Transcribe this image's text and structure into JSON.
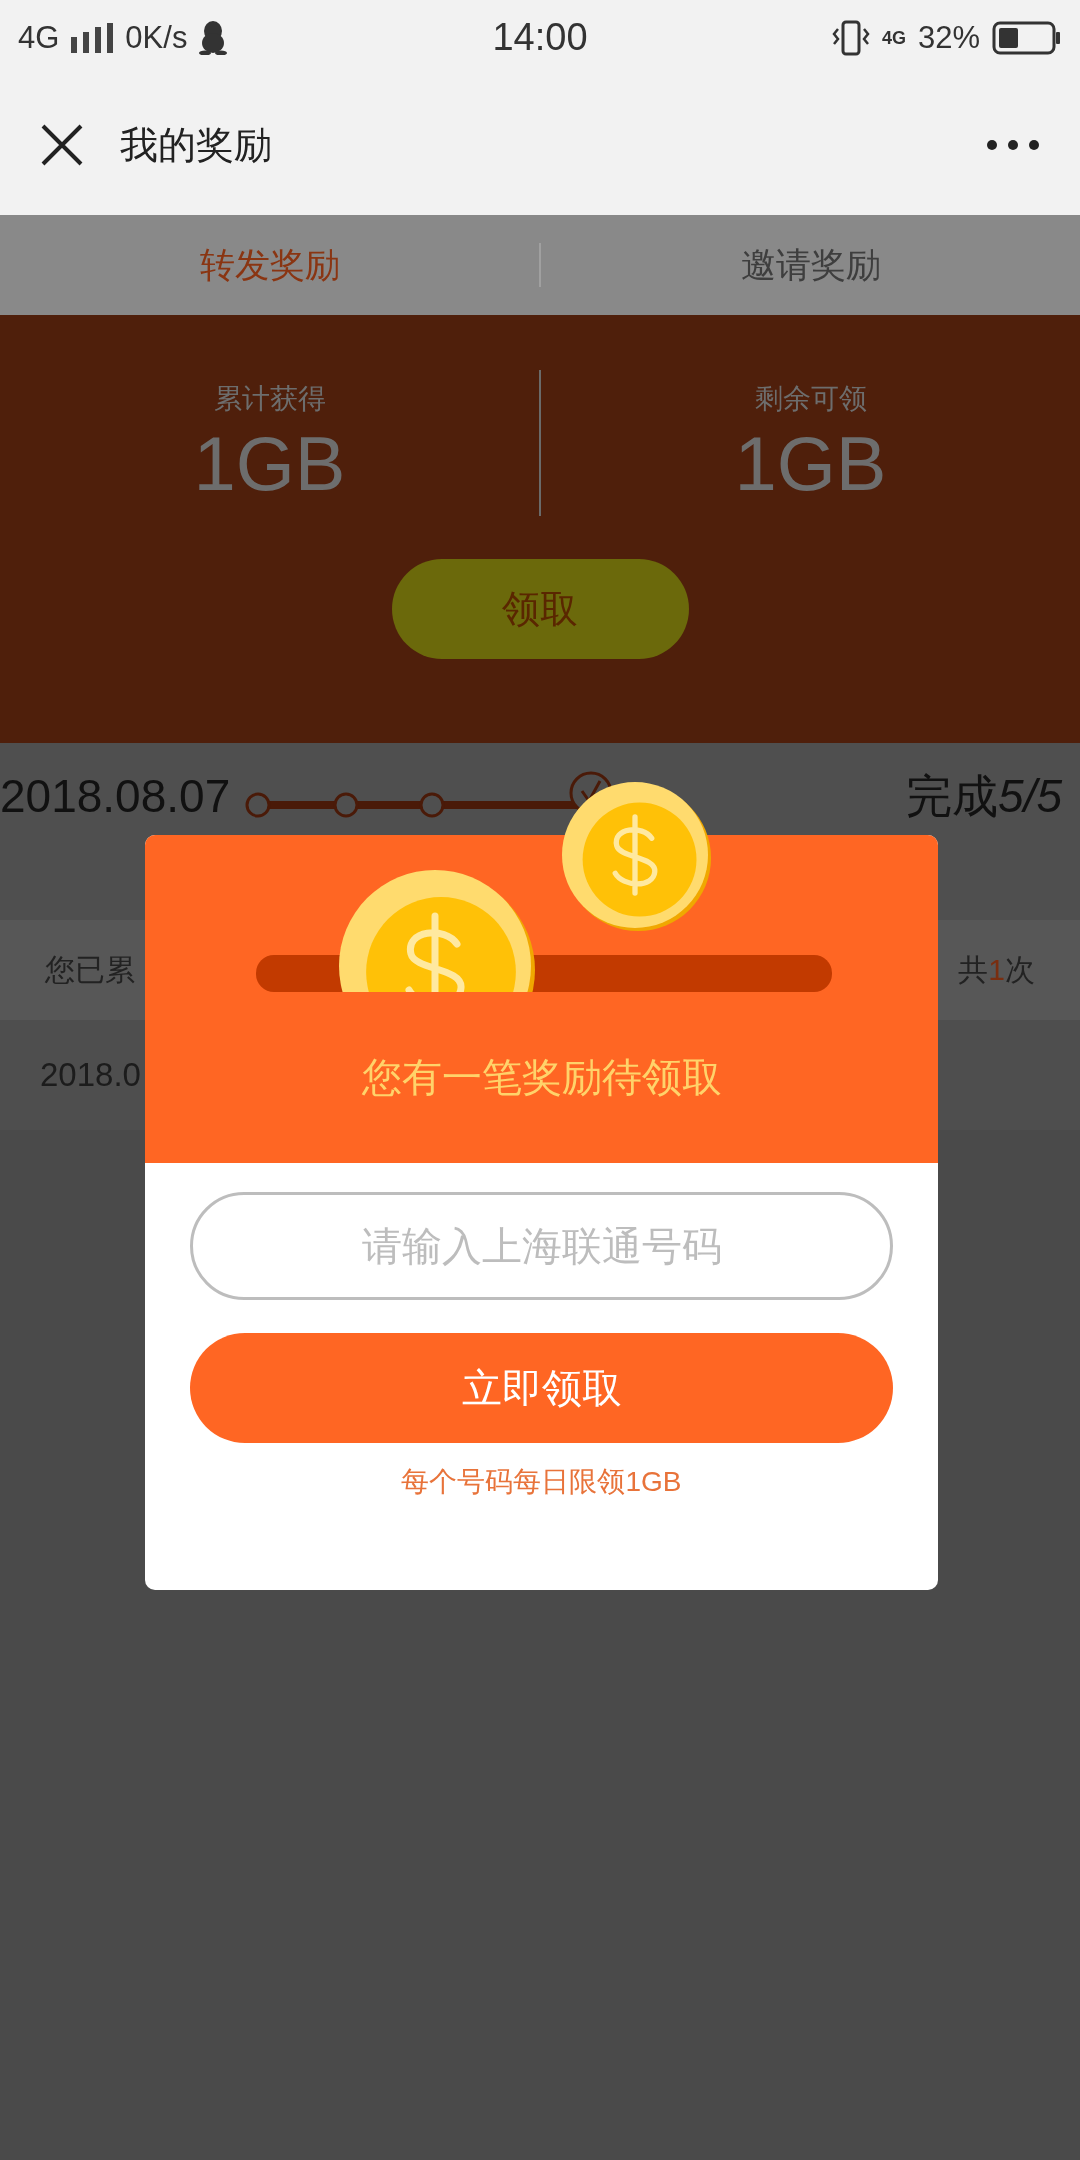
{
  "status_bar": {
    "network": "4G",
    "speed": "0K/s",
    "time": "14:00",
    "network_right": "4G",
    "battery": "32%"
  },
  "header": {
    "title": "我的奖励"
  },
  "tabs": [
    {
      "label": "转发奖励",
      "selected": true
    },
    {
      "label": "邀请奖励",
      "selected": false
    }
  ],
  "summary": {
    "stats": [
      {
        "label": "累计获得",
        "value": "1GB"
      },
      {
        "label": "剩余可领",
        "value": "1GB"
      }
    ],
    "button": "领取"
  },
  "progress": {
    "date": "2018.08.07",
    "status_label": "完成",
    "status_value": "5/5"
  },
  "record_summary": {
    "text": "您已累",
    "count_prefix": "共",
    "count": "1",
    "count_suffix": "次"
  },
  "records": [
    {
      "date": "2018.0"
    }
  ],
  "dialog": {
    "title": "您有一笔奖励待领取",
    "placeholder": "请输入上海联通号码",
    "button": "立即领取",
    "note": "每个号码每日限领1GB"
  }
}
